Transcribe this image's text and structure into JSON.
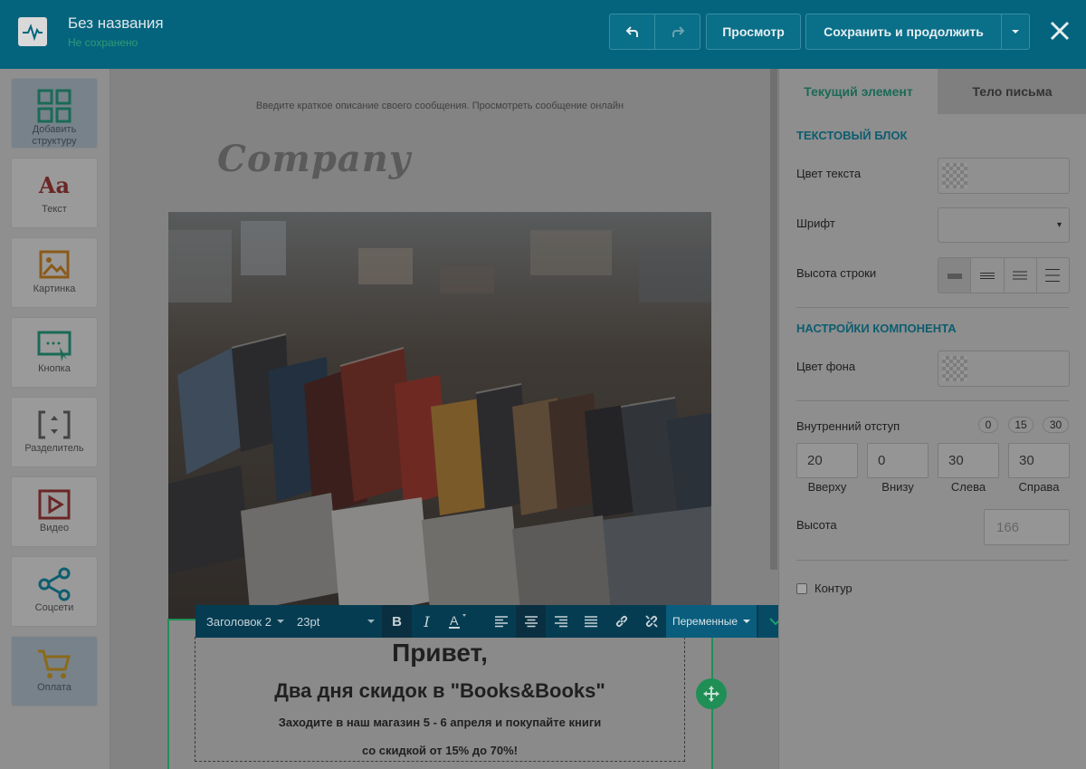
{
  "header": {
    "title": "Без названия",
    "status": "Не сохранено",
    "undo_icon": "undo-icon",
    "redo_icon": "redo-icon",
    "preview_label": "Просмотр",
    "save_label": "Сохранить и продолжить",
    "close_icon": "close-icon"
  },
  "tools": [
    {
      "label": "Добавить структуру",
      "icon": "grid-icon"
    },
    {
      "label": "Текст",
      "icon": "text-icon"
    },
    {
      "label": "Картинка",
      "icon": "image-icon"
    },
    {
      "label": "Кнопка",
      "icon": "button-icon"
    },
    {
      "label": "Разделитель",
      "icon": "divider-icon"
    },
    {
      "label": "Видео",
      "icon": "video-icon"
    },
    {
      "label": "Соцсети",
      "icon": "share-icon"
    },
    {
      "label": "Оплата",
      "icon": "cart-icon"
    }
  ],
  "canvas": {
    "preheader": "Введите краткое описание своего сообщения. Просмотреть сообщение онлайн",
    "logo_text": "Company",
    "hello": "Привет,",
    "subheading": "Два дня скидок в \"Books&Books\"",
    "line1": "Заходите в наш магазин 5 - 6 апреля и покупайте книги",
    "line2": "со скидкой от 15% до 70%!"
  },
  "format_toolbar": {
    "block_type": "Заголовок 2",
    "font_size": "23pt",
    "variables_label": "Переменные"
  },
  "right_panel": {
    "tabs": [
      "Текущий элемент",
      "Тело письма"
    ],
    "text_block_title": "ТЕКСТОВЫЙ БЛОК",
    "text_color_label": "Цвет текста",
    "font_label": "Шрифт",
    "line_height_label": "Высота строки",
    "component_settings_title": "НАСТРОЙКИ КОМПОНЕНТА",
    "bg_color_label": "Цвет фона",
    "padding_label": "Внутренний отступ",
    "padding_presets": [
      "0",
      "15",
      "30"
    ],
    "padding": [
      {
        "value": "20",
        "label": "Вверху"
      },
      {
        "value": "0",
        "label": "Внизу"
      },
      {
        "value": "30",
        "label": "Слева"
      },
      {
        "value": "30",
        "label": "Справа"
      }
    ],
    "height_label": "Высота",
    "height_placeholder": "166",
    "outline_label": "Контур"
  }
}
